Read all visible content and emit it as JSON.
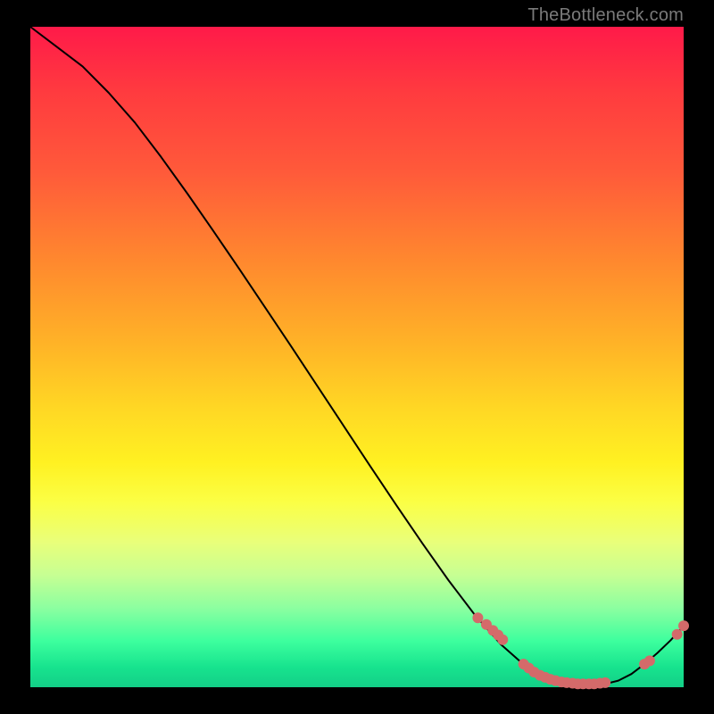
{
  "watermark": "TheBottleneck.com",
  "chart_data": {
    "type": "line",
    "title": "",
    "xlabel": "",
    "ylabel": "",
    "xlim": [
      0,
      100
    ],
    "ylim": [
      0,
      100
    ],
    "grid": false,
    "legend": false,
    "series": [
      {
        "name": "bottleneck-curve",
        "x": [
          0,
          4,
          8,
          12,
          16,
          20,
          24,
          28,
          32,
          36,
          40,
          44,
          48,
          52,
          56,
          60,
          64,
          68,
          72,
          76,
          80,
          82,
          84,
          86,
          88,
          90,
          92,
          94,
          96,
          98,
          100
        ],
        "y": [
          100,
          97,
          94,
          90,
          85.5,
          80.3,
          74.8,
          69.1,
          63.3,
          57.4,
          51.5,
          45.5,
          39.5,
          33.5,
          27.6,
          21.8,
          16.2,
          11.0,
          6.5,
          3.0,
          1.0,
          0.5,
          0.4,
          0.4,
          0.5,
          1.0,
          2.0,
          3.5,
          5.2,
          7.1,
          9.3
        ]
      }
    ],
    "markers": {
      "name": "highlighted-points",
      "x": [
        68.5,
        69.8,
        70.8,
        71.6,
        72.3,
        75.5,
        76.3,
        77.1,
        78.0,
        78.8,
        79.6,
        80.4,
        81.3,
        82.1,
        83.0,
        83.8,
        84.6,
        85.5,
        86.3,
        87.2,
        88.0,
        94.0,
        94.8,
        99.0,
        100.0
      ],
      "y": [
        10.5,
        9.5,
        8.6,
        7.9,
        7.2,
        3.5,
        2.9,
        2.3,
        1.8,
        1.5,
        1.2,
        1.0,
        0.8,
        0.7,
        0.6,
        0.5,
        0.5,
        0.5,
        0.5,
        0.6,
        0.7,
        3.5,
        4.0,
        8.0,
        9.3
      ]
    }
  }
}
